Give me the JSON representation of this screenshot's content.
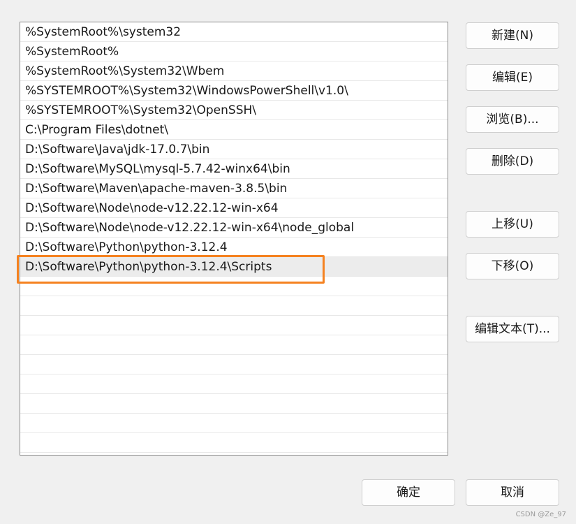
{
  "paths": [
    "%SystemRoot%\\system32",
    "%SystemRoot%",
    "%SystemRoot%\\System32\\Wbem",
    "%SYSTEMROOT%\\System32\\WindowsPowerShell\\v1.0\\",
    "%SYSTEMROOT%\\System32\\OpenSSH\\",
    "C:\\Program Files\\dotnet\\",
    "D:\\Software\\Java\\jdk-17.0.7\\bin",
    "D:\\Software\\MySQL\\mysql-5.7.42-winx64\\bin",
    "D:\\Software\\Maven\\apache-maven-3.8.5\\bin",
    "D:\\Software\\Node\\node-v12.22.12-win-x64",
    "D:\\Software\\Node\\node-v12.22.12-win-x64\\node_global",
    "D:\\Software\\Python\\python-3.12.4",
    "D:\\Software\\Python\\python-3.12.4\\Scripts"
  ],
  "buttons": {
    "new": "新建(N)",
    "edit": "编辑(E)",
    "browse": "浏览(B)...",
    "delete": "删除(D)",
    "move_up": "上移(U)",
    "move_down": "下移(O)",
    "edit_text": "编辑文本(T)...",
    "ok": "确定",
    "cancel": "取消"
  },
  "watermark": "CSDN @Ze_97",
  "colors": {
    "highlight": "#f58220",
    "background": "#f0f0f0"
  }
}
